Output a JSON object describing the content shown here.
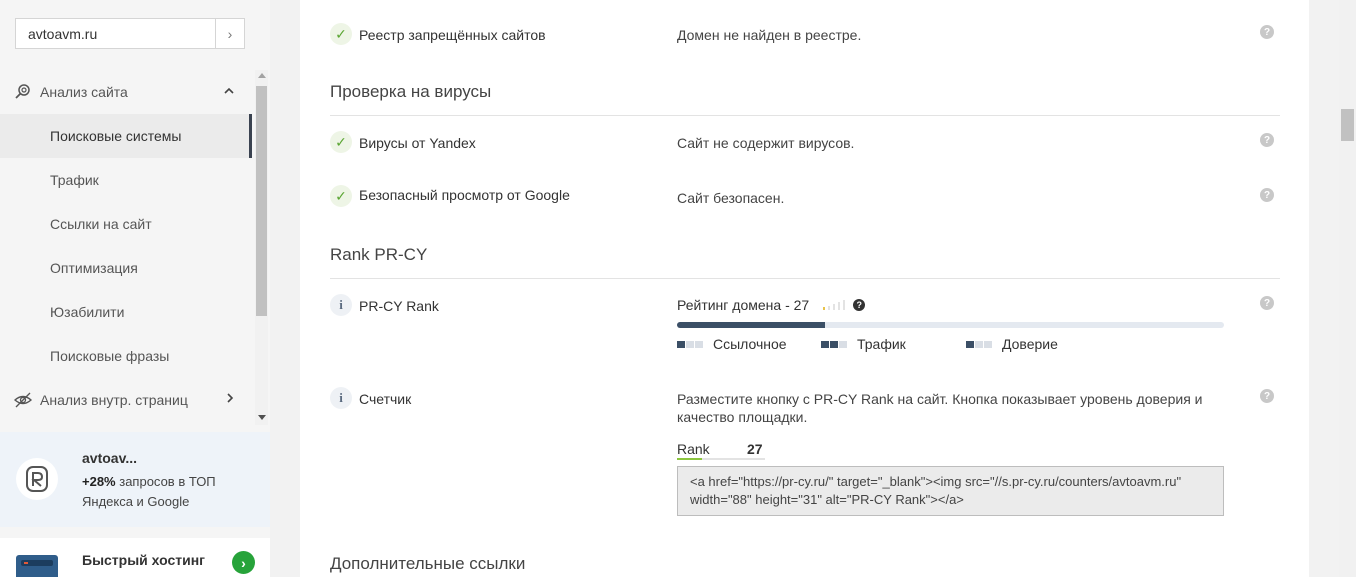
{
  "sidebar": {
    "search": {
      "value": "avtoavm.ru",
      "go": "›"
    },
    "groups": [
      {
        "label": "Анализ сайта",
        "icon": "magnifier-icon",
        "chevron": "⌃"
      },
      {
        "label": "Анализ внутр. страниц",
        "icon": "eye-icon",
        "chevron": "›"
      }
    ],
    "items": [
      {
        "label": "Поисковые системы"
      },
      {
        "label": "Трафик"
      },
      {
        "label": "Ссылки на сайт"
      },
      {
        "label": "Оптимизация"
      },
      {
        "label": "Юзабилити"
      },
      {
        "label": "Поисковые фразы"
      }
    ],
    "promo": {
      "title": "avtoav...",
      "percent": "+28%",
      "text": " запросов в ТОП Яндекса и Google"
    },
    "hosting": {
      "title": "Быстрый хостинг",
      "button": "›"
    }
  },
  "main": {
    "rows": {
      "registry": {
        "label": "Реестр запрещённых сайтов",
        "value": "Домен не найден в реестре."
      },
      "yandex": {
        "label": "Вирусы от Yandex",
        "value": "Сайт не содержит вирусов."
      },
      "google": {
        "label": "Безопасный просмотр от Google",
        "value": "Сайт безопасен."
      },
      "rank": {
        "label": "PR-CY Rank"
      },
      "counter": {
        "label": "Счетчик"
      }
    },
    "sections": {
      "viruses": "Проверка на вирусы",
      "rank": "Rank PR-CY",
      "links": "Дополнительные ссылки"
    },
    "rank": {
      "rating_text": "Рейтинг домена - 27",
      "progress_fraction": 0.27,
      "legend": [
        {
          "label": "Ссылочное",
          "filled": 1
        },
        {
          "label": "Трафик",
          "filled": 2
        },
        {
          "label": "Доверие",
          "filled": 1
        }
      ]
    },
    "counter": {
      "description": "Разместите кнопку с PR-CY Rank на сайт. Кнопка показывает уровень доверия и качество площадки.",
      "badge_label": "Rank",
      "badge_value": "27",
      "code": "<a href=\"https://pr-cy.ru/\" target=\"_blank\"><img src=\"//s.pr-cy.ru/counters/avtoavm.ru\" width=\"88\" height=\"31\" alt=\"PR-CY Rank\"></a>"
    },
    "help_symbol": "?",
    "check_symbol": "✓",
    "info_symbol": "i"
  },
  "colors": {
    "accent": "#3b4f66",
    "ok": "#5aa532",
    "host_button": "#27a33a",
    "badge_line": "#8cc63f"
  }
}
